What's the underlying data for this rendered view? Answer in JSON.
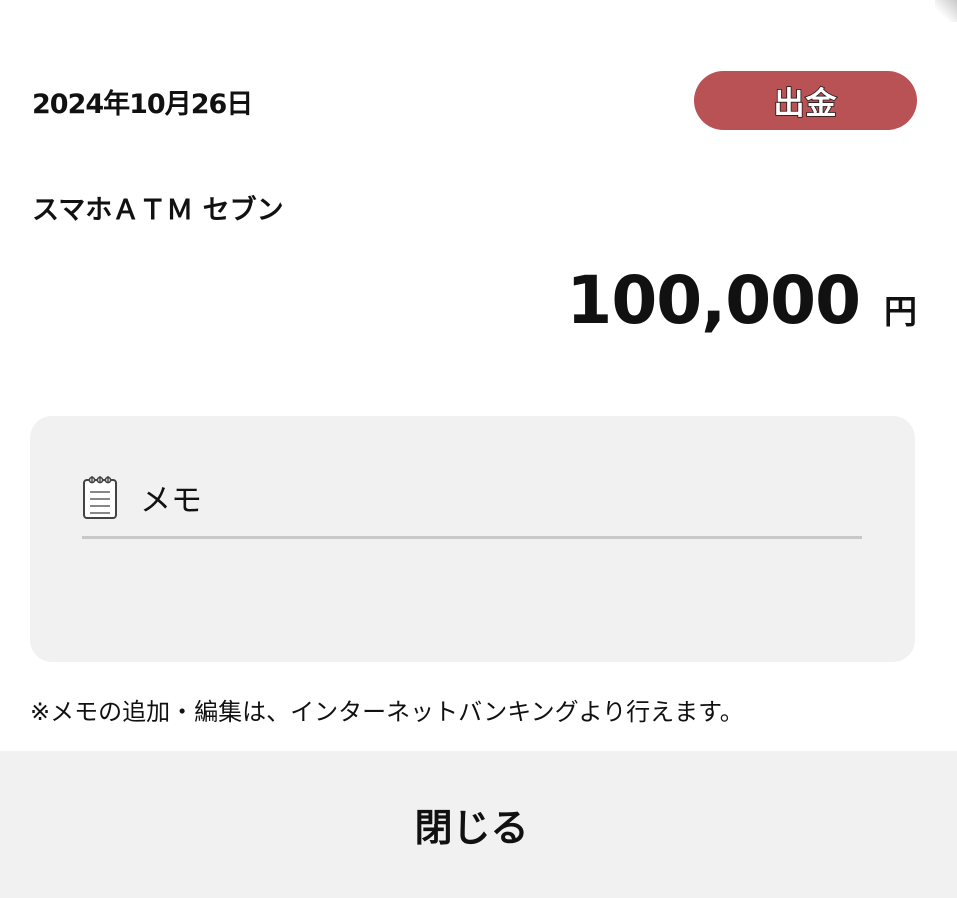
{
  "transaction": {
    "date": "2024年10月26日",
    "type_badge": "出金",
    "description": "スマホＡＴＭ セブン",
    "amount": "100,000",
    "currency": "円"
  },
  "memo": {
    "icon": "notepad-icon",
    "label": "メモ",
    "value": ""
  },
  "note": "※メモの追加・編集は、インターネットバンキングより行えます。",
  "footer": {
    "close_label": "閉じる"
  },
  "colors": {
    "badge_background": "#b85255",
    "panel_background": "#f1f1f1"
  }
}
